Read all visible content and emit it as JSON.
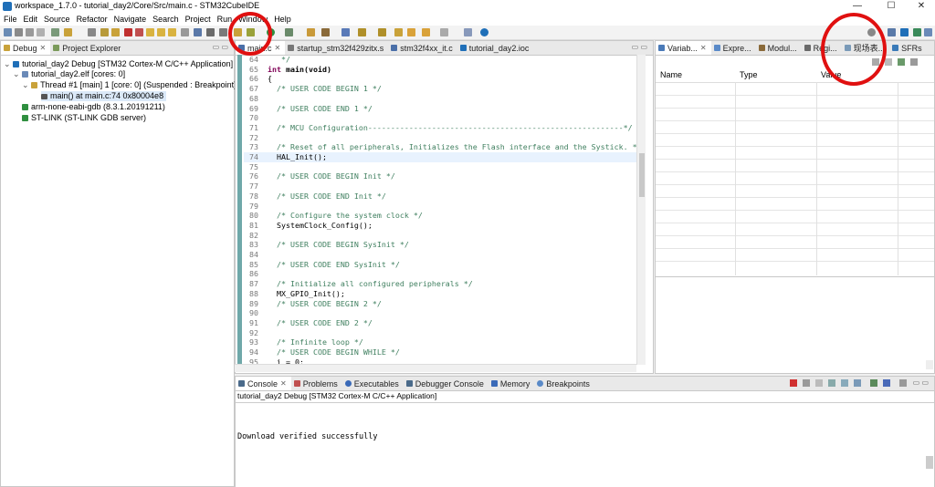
{
  "window": {
    "title": "workspace_1.7.0 - tutorial_day2/Core/Src/main.c - STM32CubeIDE",
    "minimize": "—",
    "maximize": "☐",
    "close": "✕"
  },
  "menu": [
    "File",
    "Edit",
    "Source",
    "Refactor",
    "Navigate",
    "Search",
    "Project",
    "Run",
    "Window",
    "Help"
  ],
  "left_panel": {
    "tabs": [
      {
        "label": "Debug",
        "icon": "debug-icon"
      },
      {
        "label": "Project Explorer",
        "icon": "project-explorer-icon"
      }
    ],
    "tree": [
      {
        "label": "tutorial_day2 Debug [STM32 Cortex-M C/C++ Application]",
        "level": 0,
        "icon": "launch-icon"
      },
      {
        "label": "tutorial_day2.elf [cores: 0]",
        "level": 1,
        "icon": "elf-icon"
      },
      {
        "label": "Thread #1 [main] 1 [core: 0] (Suspended : Breakpoint)",
        "level": 2,
        "icon": "thread-icon"
      },
      {
        "label": "main() at main.c:74 0x80004e8",
        "level": 3,
        "icon": "stack-frame-icon"
      },
      {
        "label": "arm-none-eabi-gdb (8.3.1.20191211)",
        "level": 1,
        "icon": "gdb-icon"
      },
      {
        "label": "ST-LINK (ST-LINK GDB server)",
        "level": 1,
        "icon": "stlink-icon"
      }
    ]
  },
  "editor": {
    "tabs": [
      {
        "label": "main.c",
        "active": true
      },
      {
        "label": "startup_stm32f429zitx.s",
        "active": false
      },
      {
        "label": "stm32f4xx_it.c",
        "active": false
      },
      {
        "label": "tutorial_day2.ioc",
        "active": false
      }
    ],
    "lines": [
      {
        "n": "64",
        "text": "   */",
        "type": "cmt"
      },
      {
        "n": "65",
        "text": "int main(void)",
        "type": "sig"
      },
      {
        "n": "66",
        "text": "{",
        "type": "code"
      },
      {
        "n": "67",
        "text": "  /* USER CODE BEGIN 1 */",
        "type": "cmt"
      },
      {
        "n": "68",
        "text": "",
        "type": "code"
      },
      {
        "n": "69",
        "text": "  /* USER CODE END 1 */",
        "type": "cmt"
      },
      {
        "n": "70",
        "text": "",
        "type": "code"
      },
      {
        "n": "71",
        "text": "  /* MCU Configuration--------------------------------------------------------*/",
        "type": "cmt"
      },
      {
        "n": "72",
        "text": "",
        "type": "code"
      },
      {
        "n": "73",
        "text": "  /* Reset of all peripherals, Initializes the Flash interface and the Systick. */",
        "type": "cmt"
      },
      {
        "n": "74",
        "text": "  HAL_Init();",
        "type": "code",
        "highlight": true
      },
      {
        "n": "75",
        "text": "",
        "type": "code"
      },
      {
        "n": "76",
        "text": "  /* USER CODE BEGIN Init */",
        "type": "cmt"
      },
      {
        "n": "77",
        "text": "",
        "type": "code"
      },
      {
        "n": "78",
        "text": "  /* USER CODE END Init */",
        "type": "cmt"
      },
      {
        "n": "79",
        "text": "",
        "type": "code"
      },
      {
        "n": "80",
        "text": "  /* Configure the system clock */",
        "type": "cmt"
      },
      {
        "n": "81",
        "text": "  SystemClock_Config();",
        "type": "code"
      },
      {
        "n": "82",
        "text": "",
        "type": "code"
      },
      {
        "n": "83",
        "text": "  /* USER CODE BEGIN SysInit */",
        "type": "cmt"
      },
      {
        "n": "84",
        "text": "",
        "type": "code"
      },
      {
        "n": "85",
        "text": "  /* USER CODE END SysInit */",
        "type": "cmt"
      },
      {
        "n": "86",
        "text": "",
        "type": "code"
      },
      {
        "n": "87",
        "text": "  /* Initialize all configured peripherals */",
        "type": "cmt"
      },
      {
        "n": "88",
        "text": "  MX_GPIO_Init();",
        "type": "code"
      },
      {
        "n": "89",
        "text": "  /* USER CODE BEGIN 2 */",
        "type": "cmt"
      },
      {
        "n": "90",
        "text": "",
        "type": "code"
      },
      {
        "n": "91",
        "text": "  /* USER CODE END 2 */",
        "type": "cmt"
      },
      {
        "n": "92",
        "text": "",
        "type": "code"
      },
      {
        "n": "93",
        "text": "  /* Infinite loop */",
        "type": "cmt"
      },
      {
        "n": "94",
        "text": "  /* USER CODE BEGIN WHILE */",
        "type": "cmt"
      },
      {
        "n": "95",
        "text": "  i = 0;",
        "type": "code"
      }
    ]
  },
  "right_panel": {
    "tabs": [
      {
        "label": "Variab...",
        "icon": "variables-icon",
        "active": true
      },
      {
        "label": "Expre...",
        "icon": "expressions-icon"
      },
      {
        "label": "Modul...",
        "icon": "modules-icon"
      },
      {
        "label": "Regi...",
        "icon": "registers-icon"
      },
      {
        "label": "现场表...",
        "icon": "live-expressions-icon"
      },
      {
        "label": "SFRs",
        "icon": "sfrs-icon"
      }
    ],
    "columns": [
      "Name",
      "Type",
      "Value"
    ]
  },
  "bottom_panel": {
    "tabs": [
      {
        "label": "Console",
        "icon": "console-icon",
        "active": true
      },
      {
        "label": "Problems",
        "icon": "problems-icon"
      },
      {
        "label": "Executables",
        "icon": "executables-icon"
      },
      {
        "label": "Debugger Console",
        "icon": "debugger-console-icon"
      },
      {
        "label": "Memory",
        "icon": "memory-icon"
      },
      {
        "label": "Breakpoints",
        "icon": "breakpoints-icon"
      }
    ],
    "header": "tutorial_day2 Debug [STM32 Cortex-M C/C++ Application]",
    "output": "Download verified successfully"
  },
  "colors": {
    "annotation": "#e01010",
    "accent": "#1f6fb8",
    "comment": "#3f7f5f",
    "keyword": "#7f0055"
  }
}
